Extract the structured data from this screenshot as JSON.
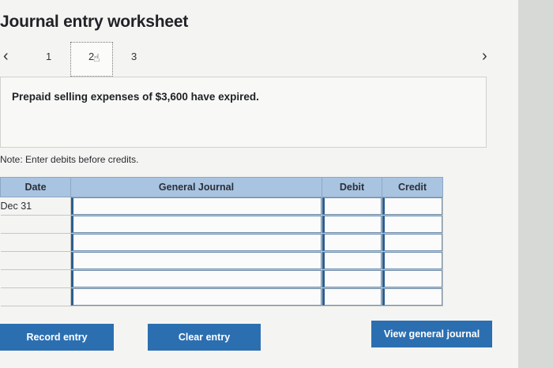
{
  "header": {
    "title": "Journal entry worksheet"
  },
  "pagination": {
    "prev_icon": "chevron-left-icon",
    "next_icon": "chevron-right-icon",
    "pages": [
      "1",
      "2",
      "3"
    ],
    "current": "2"
  },
  "prompt": {
    "text": "Prepaid selling expenses of $3,600 have expired."
  },
  "note": "Note: Enter debits before credits.",
  "journal": {
    "columns": [
      "Date",
      "General Journal",
      "Debit",
      "Credit"
    ],
    "rows": [
      {
        "date": "Dec 31",
        "account": "",
        "debit": "",
        "credit": ""
      },
      {
        "date": "",
        "account": "",
        "debit": "",
        "credit": ""
      },
      {
        "date": "",
        "account": "",
        "debit": "",
        "credit": ""
      },
      {
        "date": "",
        "account": "",
        "debit": "",
        "credit": ""
      },
      {
        "date": "",
        "account": "",
        "debit": "",
        "credit": ""
      },
      {
        "date": "",
        "account": "",
        "debit": "",
        "credit": ""
      }
    ]
  },
  "buttons": {
    "record": "Record entry",
    "clear": "Clear entry",
    "view": "View general journal"
  },
  "colors": {
    "header_bg": "#a9c4e1",
    "button_bg": "#2c6fb1",
    "input_border": "#2b5f92"
  }
}
